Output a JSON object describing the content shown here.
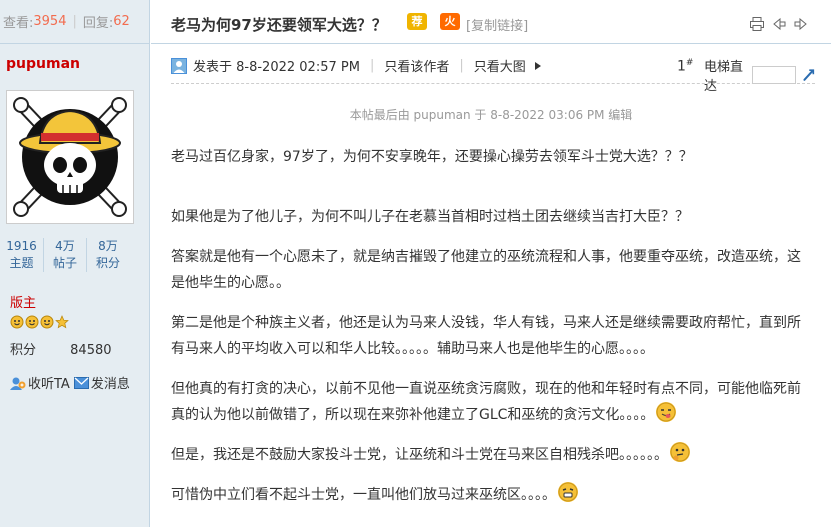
{
  "thread_stats": {
    "views_label": "查看:",
    "views": "3954",
    "replies_label": "回复:",
    "replies": "62"
  },
  "title": "老马为何97岁还要领军大选？？",
  "badges": [
    "荐",
    "火"
  ],
  "copy_link": "[复制链接]",
  "author": {
    "name": "pupuman",
    "stats": [
      {
        "value": "1916",
        "label": "主题"
      },
      {
        "value": "4万",
        "label": "帖子"
      },
      {
        "value": "8万",
        "label": "积分"
      }
    ],
    "rank": "版主",
    "points_label": "积分",
    "points": "84580",
    "listen_label": "收听TA",
    "message_label": "发消息"
  },
  "post_header": {
    "posted_at": "发表于 8-8-2022 02:57 PM",
    "only_author": "只看该作者",
    "large_image": "只看大图",
    "floor": "1",
    "floor_mark": "#",
    "elevator_label": "电梯直达"
  },
  "edit_note": "本帖最后由 pupuman 于 8-8-2022 03:06 PM 编辑",
  "paragraphs": [
    "老马过百亿身家，97岁了，为何不安享晚年，还要操心操劳去领军斗士党大选？？？",
    "如果他是为了他儿子，为何不叫儿子在老慕当首相时过档土团去继续当吉打大臣？？",
    "答案就是他有一个心愿未了，就是纳吉摧毁了他建立的巫统流程和人事，他要重夺巫统，改造巫统，这是他毕生的心愿。。",
    "第二是他是个种族主义者，他还是认为马来人没钱，华人有钱，马来人还是继续需要政府帮忙，直到所有马来人的平均收入可以和华人比较。。。。。辅助马来人也是他毕生的心愿。。。。",
    "但他真的有打贪的决心，以前不见他一直说巫统贪污腐败，现在的他和年轻时有点不同，可能他临死前真的认为他以前做错了，所以现在来弥补他建立了GLC和巫统的贪污文化。。。。",
    "但是，我还是不鼓励大家投斗士党，让巫统和斗士党在马来区自相残杀吧。。。。。。",
    "可惜伪中立们看不起斗士党，一直叫他们放马过来巫统区。。。。"
  ],
  "colors": {
    "accent_red": "#f26c4f",
    "link_blue": "#369",
    "sidebar_bg": "#e5edf2"
  }
}
